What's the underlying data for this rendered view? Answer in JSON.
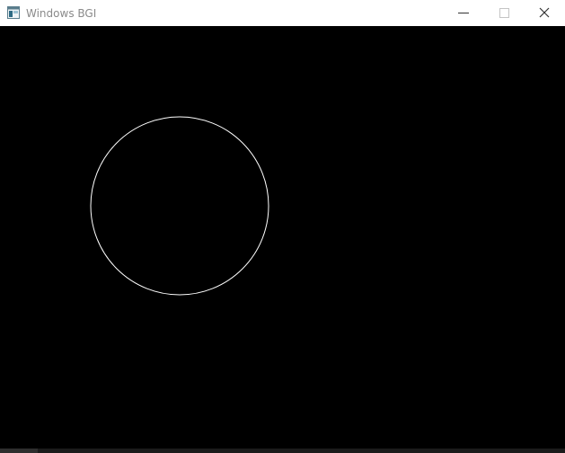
{
  "window": {
    "title": "Windows BGI",
    "icons": {
      "app": "app-window-icon",
      "minimize": "minimize-icon",
      "maximize": "maximize-icon",
      "close": "close-icon"
    }
  },
  "canvas": {
    "background_color": "#000000",
    "shapes": [
      {
        "type": "circle",
        "stroke_color": "#ffffff",
        "fill": "none"
      }
    ]
  }
}
